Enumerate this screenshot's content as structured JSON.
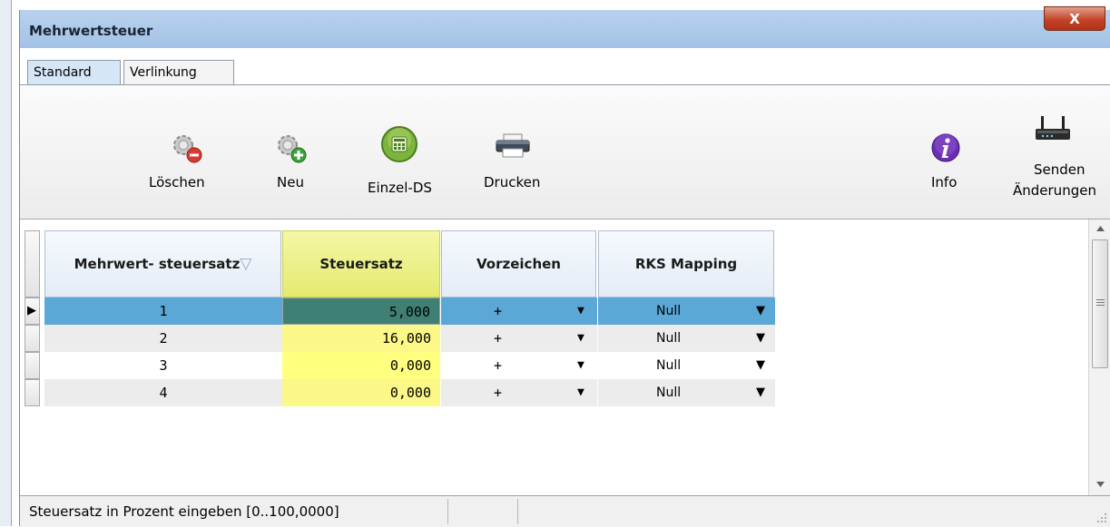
{
  "window": {
    "title": "Mehrwertsteuer",
    "close_label": "X"
  },
  "tabs": [
    {
      "label": "Standard",
      "active": true
    },
    {
      "label": "Verlinkung",
      "active": false
    }
  ],
  "toolbar": {
    "delete_label": "Löschen",
    "new_label": "Neu",
    "single_record_label": "Einzel-DS",
    "print_label": "Drucken",
    "info_label": "Info",
    "send_changes_line1": "Senden",
    "send_changes_line2": "Änderungen"
  },
  "grid": {
    "columns": [
      "Mehrwert- steuersatz",
      "Steuersatz",
      "Vorzeichen",
      "RKS Mapping"
    ],
    "sorted_column_indicator": "▽",
    "rows": [
      {
        "mehrwertsteuersatz": "1",
        "steuersatz": "5,000",
        "vorzeichen": "+",
        "rks_mapping": "Null",
        "selected": true
      },
      {
        "mehrwertsteuersatz": "2",
        "steuersatz": "16,000",
        "vorzeichen": "+",
        "rks_mapping": "Null",
        "selected": false
      },
      {
        "mehrwertsteuersatz": "3",
        "steuersatz": "0,000",
        "vorzeichen": "+",
        "rks_mapping": "Null",
        "selected": false
      },
      {
        "mehrwertsteuersatz": "4",
        "steuersatz": "0,000",
        "vorzeichen": "+",
        "rks_mapping": "Null",
        "selected": false
      }
    ],
    "dropdown_glyph": "▼",
    "current_row_glyph": "▶"
  },
  "statusbar": {
    "hint": "Steuersatz in Prozent eingeben [0..100,0000]"
  },
  "colors": {
    "selected_row": "#5ba7d6",
    "selected_editing_cell": "#3f7f74",
    "steuersatz_column": "#ffff80",
    "title_bar": "#a3c2e6"
  }
}
